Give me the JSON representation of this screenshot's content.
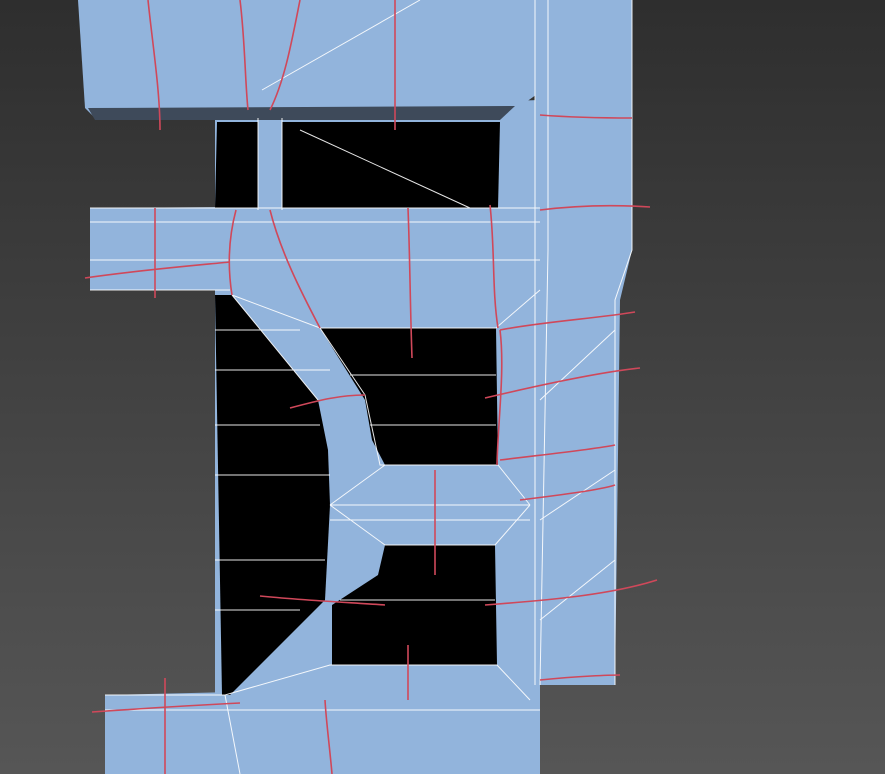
{
  "viewport": {
    "colors": {
      "background_top": "#2e2e2e",
      "background_bottom": "#565656",
      "mesh_face": "#92b4dc",
      "mesh_shadow": "#6c8cb4",
      "hole": "#000000",
      "wire": "#ffffff",
      "seam": "#d0485a"
    }
  }
}
